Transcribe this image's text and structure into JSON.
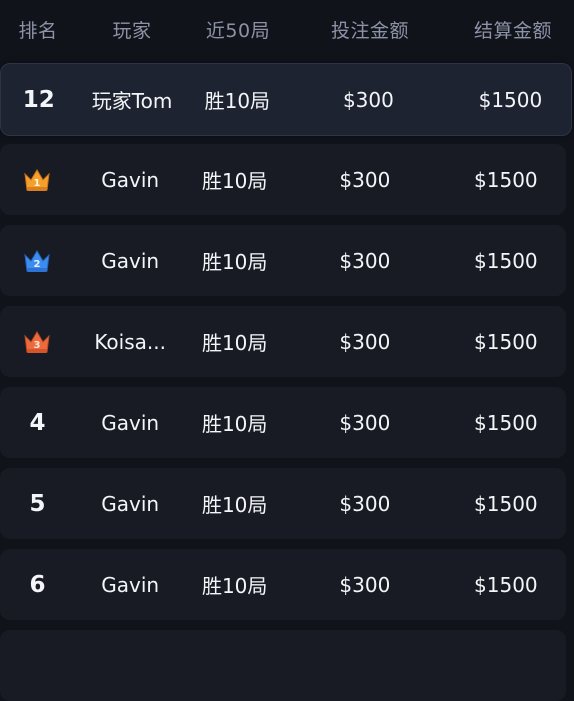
{
  "header": {
    "rank": "排名",
    "player": "玩家",
    "recent": "近50局",
    "bet": "投注金额",
    "settle": "结算金额"
  },
  "rows": [
    {
      "rank": "12",
      "player": "玩家Tom",
      "recent": "胜10局",
      "bet": "$300",
      "settle": "$1500",
      "highlight": true
    },
    {
      "rank": "1",
      "player": "Gavin",
      "recent": "胜10局",
      "bet": "$300",
      "settle": "$1500",
      "icon": "gold-crown-icon",
      "icon_color": "#f4a02b"
    },
    {
      "rank": "2",
      "player": "Gavin",
      "recent": "胜10局",
      "bet": "$300",
      "settle": "$1500",
      "icon": "blue-crown-icon",
      "icon_color": "#3d8cf0"
    },
    {
      "rank": "3",
      "player": "Koisa...",
      "recent": "胜10局",
      "bet": "$300",
      "settle": "$1500",
      "icon": "bronze-crown-icon",
      "icon_color": "#ec6a3c"
    },
    {
      "rank": "4",
      "player": "Gavin",
      "recent": "胜10局",
      "bet": "$300",
      "settle": "$1500"
    },
    {
      "rank": "5",
      "player": "Gavin",
      "recent": "胜10局",
      "bet": "$300",
      "settle": "$1500"
    },
    {
      "rank": "6",
      "player": "Gavin",
      "recent": "胜10局",
      "bet": "$300",
      "settle": "$1500"
    }
  ]
}
